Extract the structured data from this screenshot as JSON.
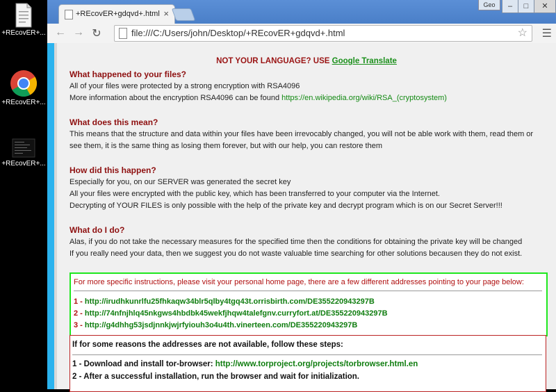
{
  "desktop": {
    "icons": [
      {
        "label": "+REcovER+..."
      },
      {
        "label": "+REcovER+..."
      },
      {
        "label": "+REcovER+..."
      }
    ]
  },
  "browser": {
    "tab_title": "+REcovER+gdqvd+.html",
    "tab_close": "×",
    "profile": "Geo",
    "url": "file:///C:/Users/john/Desktop/+REcovER+gdqvd+.html",
    "win_minimize": "–",
    "win_maximize": "□",
    "win_close": "✕"
  },
  "page": {
    "header_text": "NOT YOUR LANGUAGE? USE",
    "header_link": "Google Translate",
    "s1_title": "What happened to your files?",
    "s1_p1": "All of your files were protected by a strong encryption with RSA4096",
    "s1_p2": "More information about the encryption RSA4096 can be found",
    "s1_link": "https://en.wikipedia.org/wiki/RSA_(cryptosystem)",
    "s2_title": "What does this mean?",
    "s2_p1": "This means that the structure and data within your files have been irrevocably changed, you will not be able work with them, read them or",
    "s2_p2": "see them, it is the same thing as losing them forever, but with our help, you can restore them",
    "s3_title": "How did this happen?",
    "s3_p1": "Especially for you, on our SERVER was generated the secret key",
    "s3_p2": "All your files were encrypted with the public key, which has been transferred to your computer via the Internet.",
    "s3_p3": "Decrypting of YOUR FILES is only possible with the help of the private key and decrypt program which is on our Secret Server!!!",
    "s4_title": "What do I do?",
    "s4_p1": "Alas, if you do not take the necessary measures for the specified time then the conditions for obtaining the private key will be changed",
    "s4_p2": "If you really need your data, then we suggest you do not waste valuable time searching for other solutions becausen they do not exist.",
    "box1_intro": "For more specific instructions, please visit your personal home page, there are a few different addresses pointing to your page below:",
    "links": [
      {
        "num": "1 -",
        "url": "http://irudhkunrlfu25fhkaqw34blr5qlby4tgq43t.orrisbirth.com/DE355220943297B"
      },
      {
        "num": "2 -",
        "url": "http://74nfnjhlq45nkgws4hbdbk45wekfjhqw4talefgnv.curryfort.at/DE355220943297B"
      },
      {
        "num": "3 -",
        "url": "http://g4dhhg53jsdjnnkjwjrfyiouh3o4u4th.vinerteen.com/DE355220943297B"
      }
    ],
    "box2_title": "If for some reasons the addresses are not available, follow these steps:",
    "step1_text": "1 - Download and install tor-browser:",
    "step1_link": "http://www.torproject.org/projects/torbrowser.html.en",
    "step2_text": "2 - After a successful installation, run the browser and wait for initialization."
  }
}
